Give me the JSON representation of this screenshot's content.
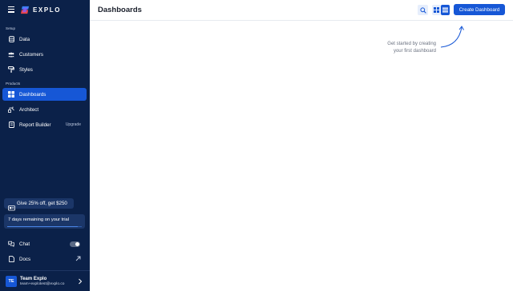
{
  "app": {
    "brand": "EXPLO"
  },
  "sidebar": {
    "sections": [
      {
        "label": "Setup"
      },
      {
        "label": "Products"
      }
    ],
    "items": [
      {
        "label": "Data",
        "icon": "database-icon"
      },
      {
        "label": "Customers",
        "icon": "users-icon"
      },
      {
        "label": "Styles",
        "icon": "paint-roller-icon"
      },
      {
        "label": "Dashboards",
        "icon": "dashboard-grid-icon",
        "active": true
      },
      {
        "label": "Architect",
        "icon": "architect-icon"
      },
      {
        "label": "Report Builder",
        "icon": "report-icon",
        "extra": "Upgrade"
      }
    ],
    "promo": {
      "label": "Give 25% off, get $250",
      "icon": "gift-icon"
    },
    "trial": {
      "label": "7 days remaining on your trial",
      "progress": 0.95
    },
    "bottom_items": [
      {
        "label": "Chat",
        "icon": "chat-icon",
        "toggle": true
      },
      {
        "label": "Docs",
        "icon": "docs-icon",
        "external": true
      }
    ],
    "user": {
      "initials": "TE",
      "name": "Team Explo",
      "email": "team+explotest@explo.co"
    }
  },
  "header": {
    "title": "Dashboards",
    "create_label": "Create Dashboard"
  },
  "empty_state": {
    "hint_line1": "Get started by creating",
    "hint_line2": "your first dashboard"
  },
  "colors": {
    "sidebar_bg": "#0b2149",
    "accent": "#1657d6",
    "hint_text": "#6b7280"
  }
}
